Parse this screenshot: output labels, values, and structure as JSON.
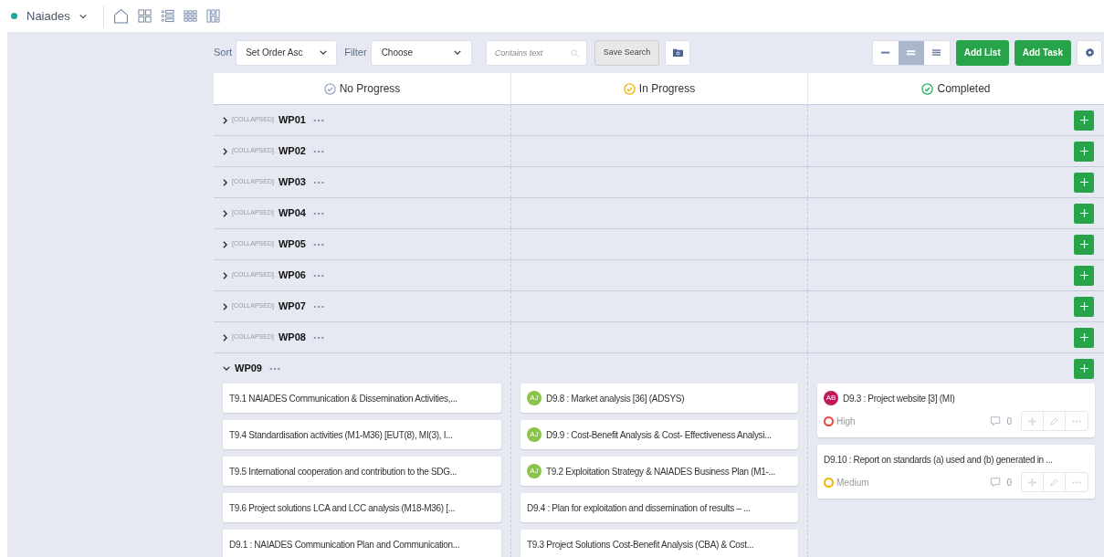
{
  "project": {
    "name": "Naiades"
  },
  "toolbar": {
    "sort_label": "Sort",
    "sort_value": "Set Order Asc",
    "filter_label": "Filter",
    "filter_value": "Choose",
    "search_placeholder": "Contains text",
    "save_search": "Save Search",
    "density": [
      {
        "kind": "compact",
        "selected": false
      },
      {
        "kind": "normal",
        "selected": true
      },
      {
        "kind": "wide",
        "selected": false
      }
    ],
    "add_list": "Add List",
    "add_task": "Add Task"
  },
  "columns": [
    {
      "title": "No Progress",
      "kind": "none"
    },
    {
      "title": "In Progress",
      "kind": "progress"
    },
    {
      "title": "Completed",
      "kind": "done"
    }
  ],
  "groups": [
    {
      "name": "WP01",
      "tag": "[COLLAPSED]",
      "expanded": false
    },
    {
      "name": "WP02",
      "tag": "[COLLAPSED]",
      "expanded": false
    },
    {
      "name": "WP03",
      "tag": "[COLLAPSED]",
      "expanded": false
    },
    {
      "name": "WP04",
      "tag": "[COLLAPSED]",
      "expanded": false
    },
    {
      "name": "WP05",
      "tag": "[COLLAPSED]",
      "expanded": false
    },
    {
      "name": "WP06",
      "tag": "[COLLAPSED]",
      "expanded": false
    },
    {
      "name": "WP07",
      "tag": "[COLLAPSED]",
      "expanded": false
    },
    {
      "name": "WP08",
      "tag": "[COLLAPSED]",
      "expanded": false
    },
    {
      "name": "WP09",
      "expanded": true,
      "lanes": [
        [
          {
            "title": "T9.1 NAIADES Communication & Dissemination Activities,..."
          },
          {
            "title": "T9.4 Standardisation activities (M1-M36) [EUT(8), MI(3), I..."
          },
          {
            "title": "T9.5 International cooperation and contribution to the SDG..."
          },
          {
            "title": "T9.6 Project solutions LCA and LCC analysis (M18-M36) [..."
          },
          {
            "title": "D9.1 : NAIADES Communication Plan and Communication..."
          }
        ],
        [
          {
            "title": "D9.8 : Market analysis [36] (ADSYS)",
            "avatar": {
              "initials": "AJ",
              "color": "#8bc34a"
            }
          },
          {
            "title": "D9.9 : Cost-Benefit Analysis & Cost- Effectiveness Analysi...",
            "avatar": {
              "initials": "AJ",
              "color": "#8bc34a"
            }
          },
          {
            "title": "T9.2 Exploitation Strategy & NAIADES Business Plan (M1-...",
            "avatar": {
              "initials": "AJ",
              "color": "#8bc34a"
            }
          },
          {
            "title": "D9.4 : Plan for exploitation and dissemination of results – ..."
          },
          {
            "title": "T9.3 Project Solutions Cost-Benefit Analysis (CBA) & Cost..."
          }
        ],
        [
          {
            "title": "D9.3 : Project website [3] (MI)",
            "avatar": {
              "initials": "AB",
              "color": "#c2185b"
            },
            "priority": {
              "label": "High",
              "color": "#f44336"
            },
            "comments": "0"
          },
          {
            "title": "D9.10 : Report on standards (a) used and (b) generated in ...",
            "priority": {
              "label": "Medium",
              "color": "#f0b400"
            },
            "comments": "0"
          }
        ]
      ]
    }
  ]
}
